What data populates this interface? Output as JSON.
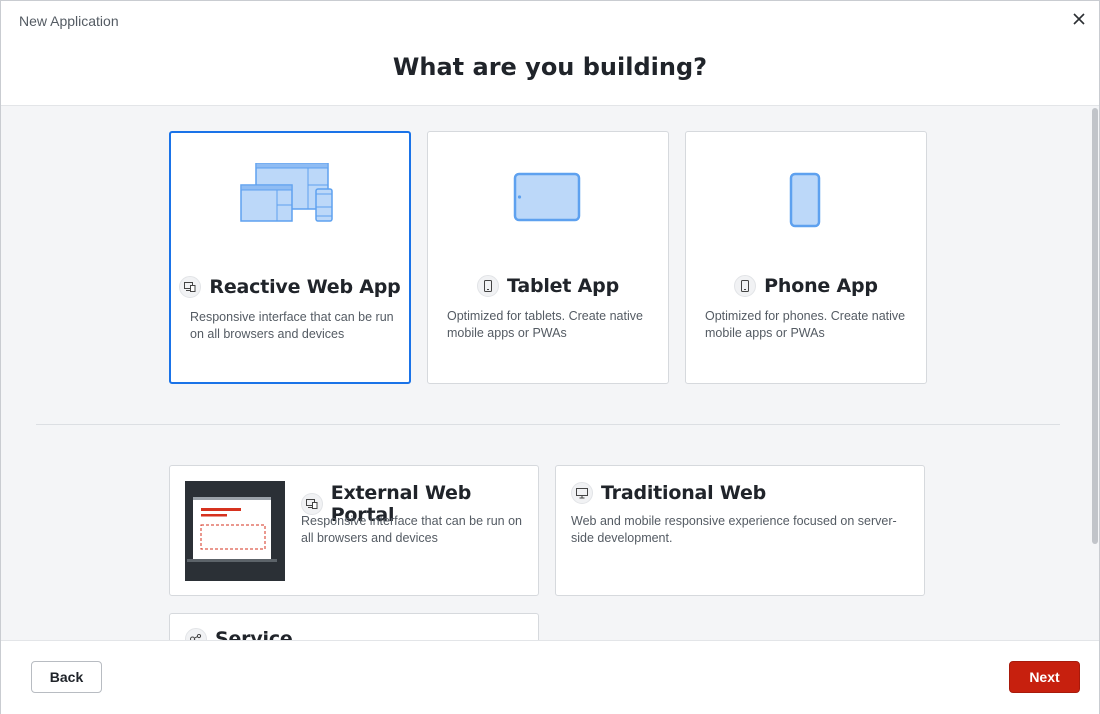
{
  "window": {
    "title": "New Application",
    "close_icon": "close-icon"
  },
  "heading": "What are you building?",
  "cards": {
    "reactive": {
      "title": "Reactive Web App",
      "desc": "Responsive interface that can be run on all browsers and devices",
      "icon": "devices-icon",
      "selected": true
    },
    "tablet": {
      "title": "Tablet App",
      "desc": "Optimized for tablets. Create native mobile apps or PWAs",
      "icon": "tablet-icon"
    },
    "phone": {
      "title": "Phone App",
      "desc": "Optimized for phones. Create native mobile apps or PWAs",
      "icon": "phone-icon"
    },
    "portal": {
      "title": "External Web Portal",
      "desc": "Responsive interface that can be run on all browsers and devices",
      "icon": "devices-icon"
    },
    "traditional": {
      "title": "Traditional Web",
      "desc": "Web and mobile responsive experience focused on server-side development.",
      "icon": "monitor-icon"
    },
    "service": {
      "title": "Service",
      "icon": "service-icon"
    }
  },
  "footer": {
    "back_label": "Back",
    "next_label": "Next"
  },
  "colors": {
    "accent": "#1a73e8",
    "primary_button": "#c7200e",
    "content_bg": "#f4f5f7",
    "illustration_fill": "#bcd8f9",
    "illustration_stroke": "#5ea1ef"
  }
}
